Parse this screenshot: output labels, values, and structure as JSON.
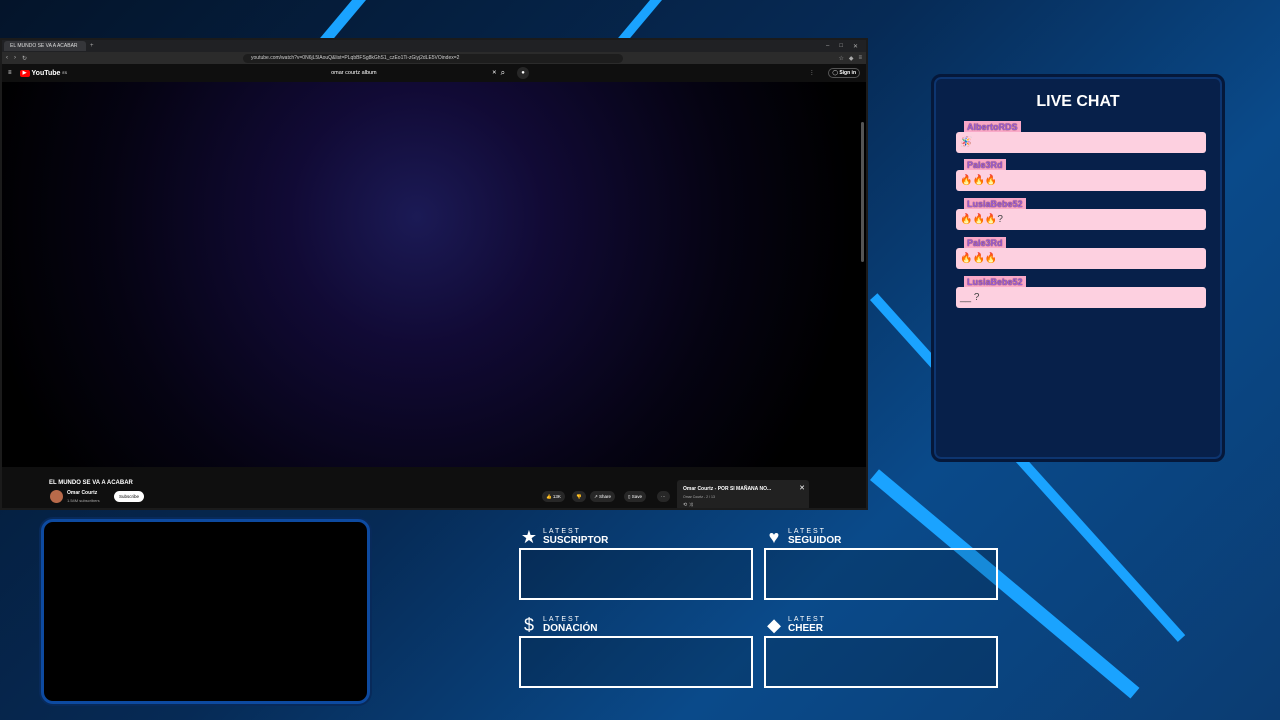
{
  "browser": {
    "tab_title": "EL MUNDO SE VA A ACABAR",
    "url": "youtube.com/watch?v=0N6jL5lAouQ&list=PLqbBFSg8kGhS1_czEo1Ti-zGiyj2dLE5VOindex=2"
  },
  "youtube": {
    "logo": "YouTube",
    "logo_country": "ES",
    "search_value": "omar courtz album",
    "sign_in": "Sign in",
    "video_title": "EL MUNDO SE VA A ACABAR",
    "channel": "Omar Courtz",
    "subscribers": "1.54M subscribers",
    "subscribe_label": "Subscribe",
    "likes": "13K",
    "share_label": "Share",
    "save_label": "Save",
    "playlist_title": "Omar Courtz - POR SI MAÑANA NO...",
    "playlist_sub": "Omar Courtz - 2 / 13"
  },
  "chat": {
    "title": "LIVE CHAT",
    "messages": [
      {
        "user": "AlbertoRDS",
        "text": "🪅"
      },
      {
        "user": "Pale3Rd",
        "text": "🔥🔥🔥"
      },
      {
        "user": "LusiaBebe52",
        "text": "🔥🔥🔥?"
      },
      {
        "user": "Pale3Rd",
        "text": "🔥🔥🔥"
      },
      {
        "user": "LusiaBebe52",
        "text": "__ ?"
      }
    ]
  },
  "alerts": {
    "suscriptor": {
      "top": "LATEST",
      "main": "SUSCRIPTOR",
      "icon": "star-icon"
    },
    "seguidor": {
      "top": "LATEST",
      "main": "SEGUIDOR",
      "icon": "heart-icon"
    },
    "donacion": {
      "top": "LATEST",
      "main": "DONACIÓN",
      "icon": "dollar-icon"
    },
    "cheer": {
      "top": "LATEST",
      "main": "CHEER",
      "icon": "diamond-icon"
    }
  },
  "colors": {
    "accent": "#1aa3ff",
    "bubble": "#fdd0e0",
    "username_bg": "#f9a8c8"
  }
}
